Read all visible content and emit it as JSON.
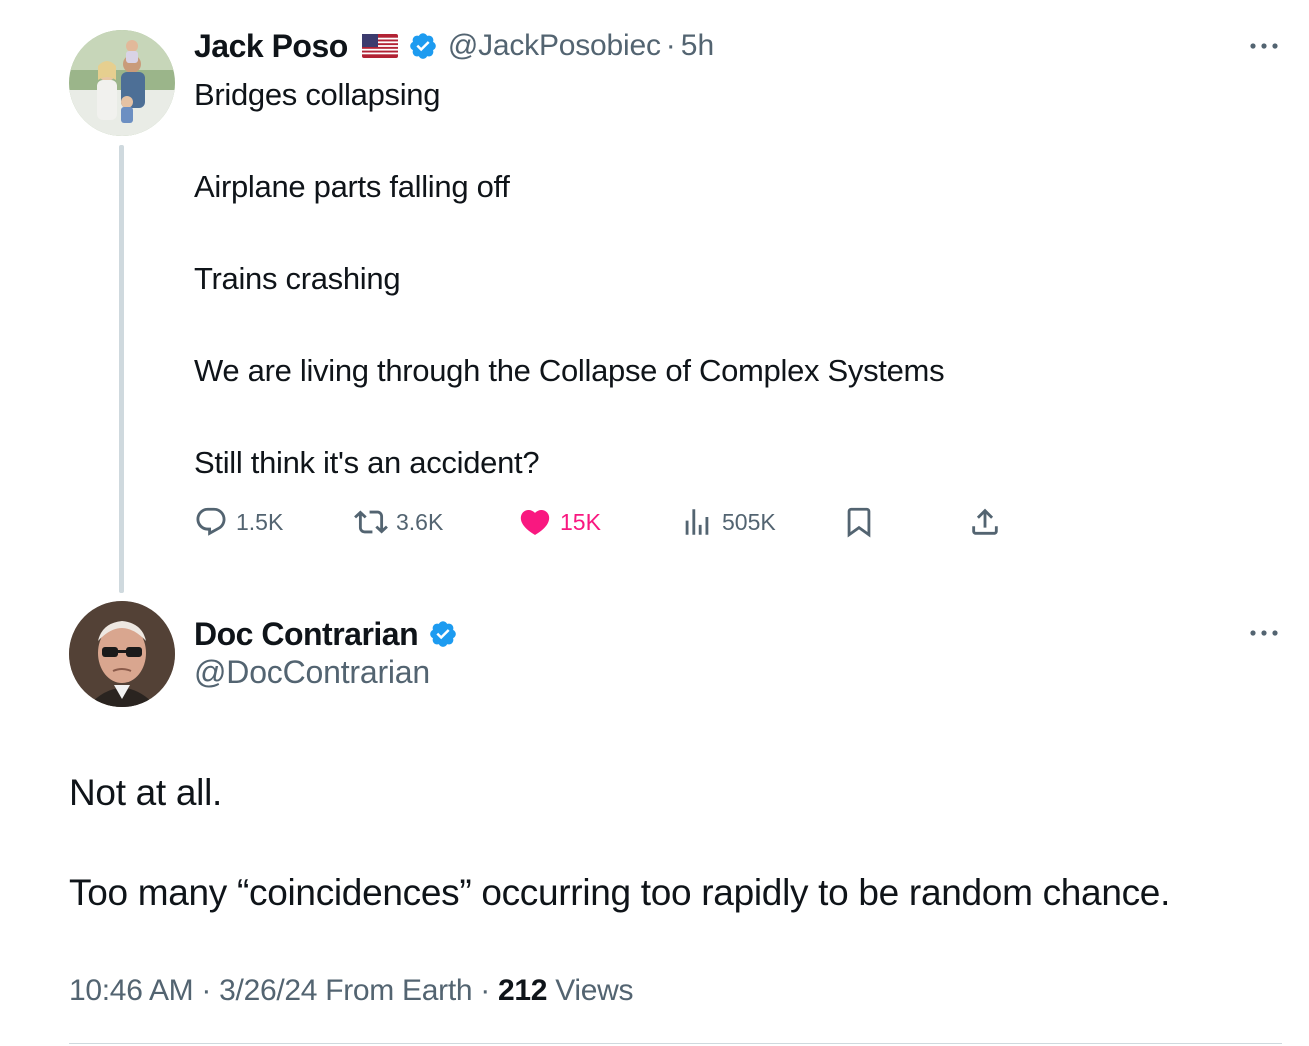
{
  "colors": {
    "text": "#0f1419",
    "secondary": "#536471",
    "verified": "#1d9bf0",
    "like": "#f91880",
    "thread_line": "#cfd9de"
  },
  "parent_tweet": {
    "display_name": "Jack Poso",
    "flag_icon": "us-flag-icon",
    "handle": "@JackPosobiec",
    "separator": "·",
    "time": "5h",
    "lines": [
      "Bridges collapsing",
      "Airplane parts falling off",
      "Trains crashing",
      "We are living through the Collapse of Complex Systems",
      "Still think it's an accident?"
    ],
    "actions": {
      "replies": "1.5K",
      "retweets": "3.6K",
      "likes": "15K",
      "views": "505K"
    }
  },
  "tweet": {
    "display_name": "Doc Contrarian",
    "handle": "@DocContrarian",
    "lines": [
      "Not at all.",
      "Too many “coincidences” occurring too rapidly to be random chance."
    ],
    "meta": {
      "time": "10:46 AM",
      "sep1": "·",
      "date": "3/26/24",
      "source": "From Earth",
      "sep2": "·",
      "views_count": "212",
      "views_label": "Views"
    }
  }
}
